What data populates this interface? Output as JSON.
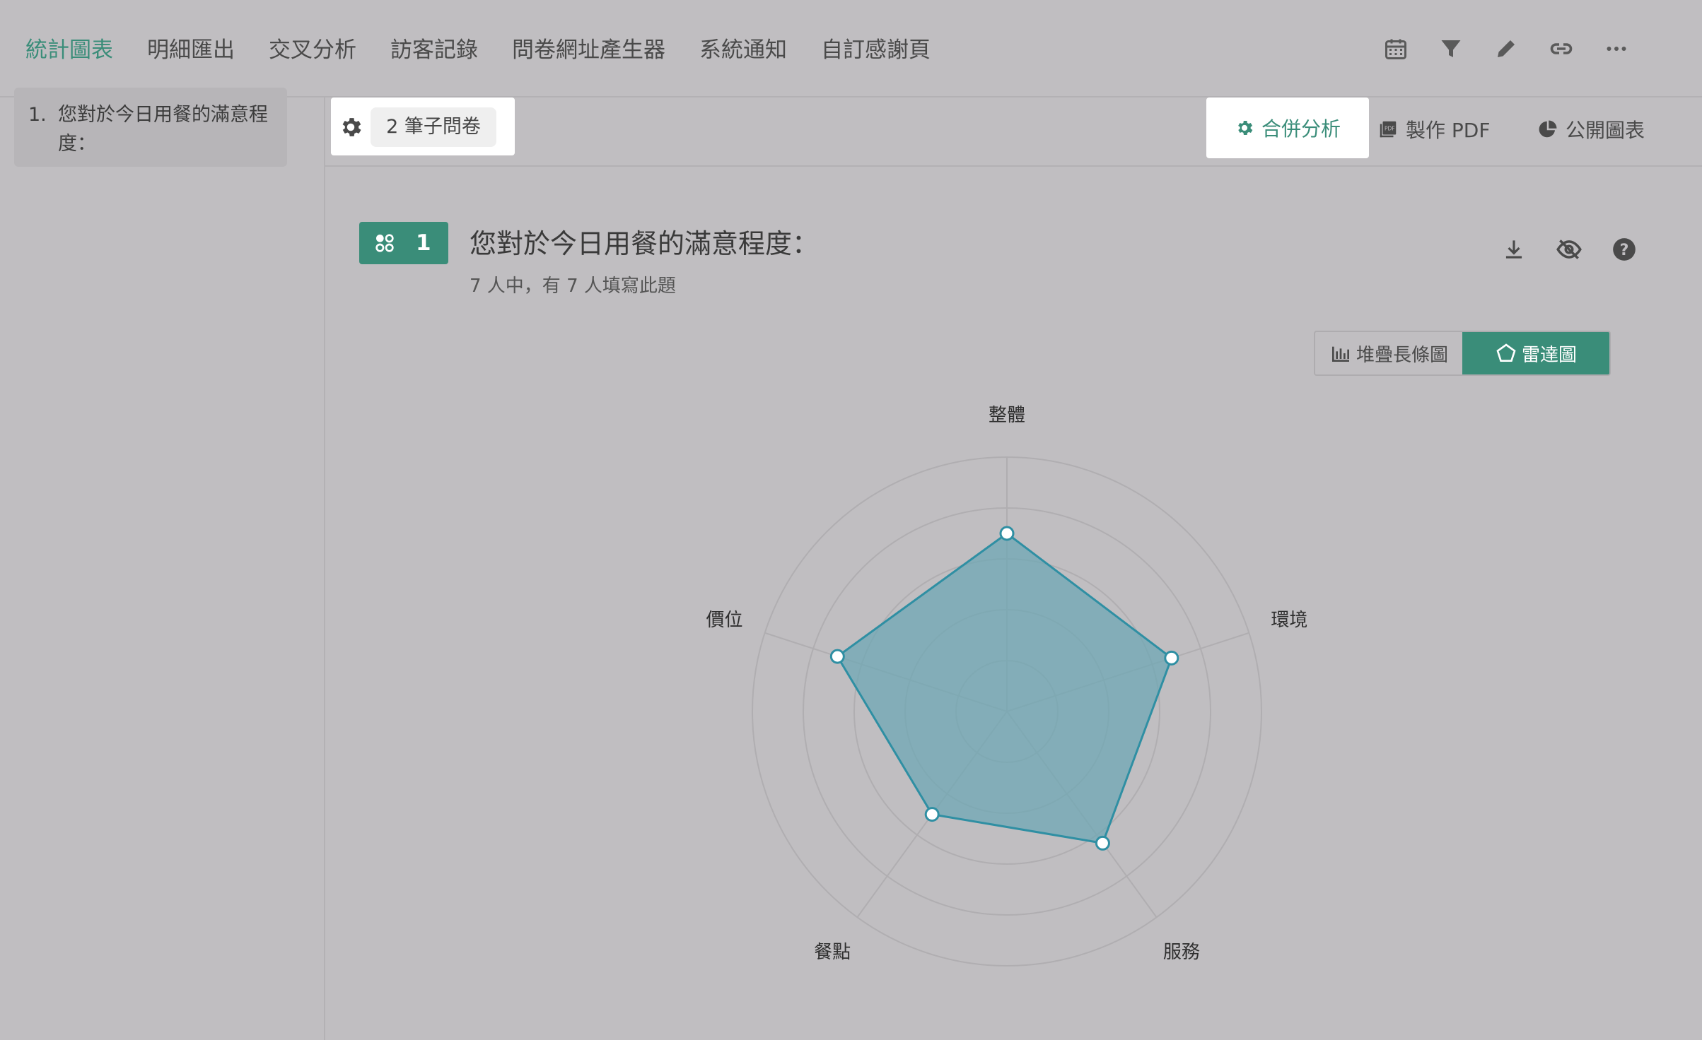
{
  "nav": {
    "tabs": [
      {
        "label": "統計圖表",
        "active": true
      },
      {
        "label": "明細匯出",
        "active": false
      },
      {
        "label": "交叉分析",
        "active": false
      },
      {
        "label": "訪客記錄",
        "active": false
      },
      {
        "label": "問卷網址產生器",
        "active": false
      },
      {
        "label": "系統通知",
        "active": false
      },
      {
        "label": "自訂感謝頁",
        "active": false
      }
    ],
    "tool_icons": [
      "calendar-icon",
      "filter-icon",
      "pencil-icon",
      "link-icon",
      "more-icon"
    ]
  },
  "sidebar": {
    "items": [
      {
        "number": "1.",
        "label": "您對於今日用餐的滿意程度："
      }
    ]
  },
  "subbar": {
    "subset_label": "2 筆子問卷",
    "merge_label": "合併分析",
    "pdf_label": "製作 PDF",
    "public_label": "公開圖表"
  },
  "question": {
    "number": "1",
    "title": "您對於今日用餐的滿意程度：",
    "subtitle": "7 人中，有 7 人填寫此題"
  },
  "chart_toggle": {
    "stacked_label": "堆疊長條圖",
    "radar_label": "雷達圖",
    "selected": "radar"
  },
  "colors": {
    "accent": "#3a8d79",
    "series_line": "#2f8fa3",
    "series_fill": "#6fa7b4"
  },
  "chart_data": {
    "type": "radar",
    "categories": [
      "整體",
      "環境",
      "服務",
      "餐點",
      "價位"
    ],
    "values": [
      3.5,
      3.4,
      3.2,
      2.5,
      3.5
    ],
    "rmax": 5,
    "rings": 5,
    "grid": true
  }
}
